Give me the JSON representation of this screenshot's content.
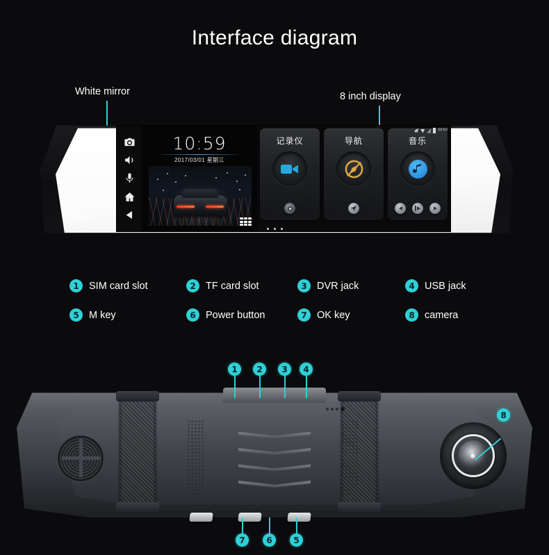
{
  "page": {
    "title": "Interface diagram",
    "accent_color": "#2fd0d6",
    "background_color": "#0b0b0d"
  },
  "top_callouts": [
    {
      "label": "White mirror"
    },
    {
      "label": "8 inch display"
    }
  ],
  "device_screen": {
    "status_bar": {
      "time": "10:59",
      "icons": [
        "airplane-icon",
        "wifi-icon",
        "signal-icon",
        "battery-icon"
      ]
    },
    "sidebar_icons": [
      "camera-icon",
      "volume-icon",
      "microphone-icon",
      "home-icon",
      "back-icon"
    ],
    "home": {
      "clock": "10:59",
      "date": "2017/03/01 星期三",
      "app_drawer_icon": "grid-icon"
    },
    "cards": [
      {
        "title": "记录仪",
        "icon": "video-camera-icon",
        "icon_color": "#29a8e0",
        "footer_icon": "record-icon"
      },
      {
        "title": "导航",
        "icon": "compass-icon",
        "icon_color": "#e0a93c",
        "footer_icon": "navigate-arrow-icon"
      },
      {
        "title": "音乐",
        "icon": "music-note-icon",
        "icon_color": "#2f9fe8",
        "footer_controls": [
          "prev-icon",
          "play-icon",
          "next-icon"
        ]
      }
    ],
    "page_dots": 3
  },
  "legend": [
    {
      "num": "1",
      "label": "SIM card slot"
    },
    {
      "num": "2",
      "label": "TF card slot"
    },
    {
      "num": "3",
      "label": "DVR jack"
    },
    {
      "num": "4",
      "label": "USB jack"
    },
    {
      "num": "5",
      "label": "M key"
    },
    {
      "num": "6",
      "label": "Power button"
    },
    {
      "num": "7",
      "label": "OK key"
    },
    {
      "num": "8",
      "label": "camera"
    }
  ],
  "rear_callouts": [
    {
      "num": "1",
      "position": "top"
    },
    {
      "num": "2",
      "position": "top"
    },
    {
      "num": "3",
      "position": "top"
    },
    {
      "num": "4",
      "position": "top"
    },
    {
      "num": "5",
      "position": "bottom"
    },
    {
      "num": "6",
      "position": "bottom"
    },
    {
      "num": "7",
      "position": "bottom"
    },
    {
      "num": "8",
      "position": "right"
    }
  ]
}
